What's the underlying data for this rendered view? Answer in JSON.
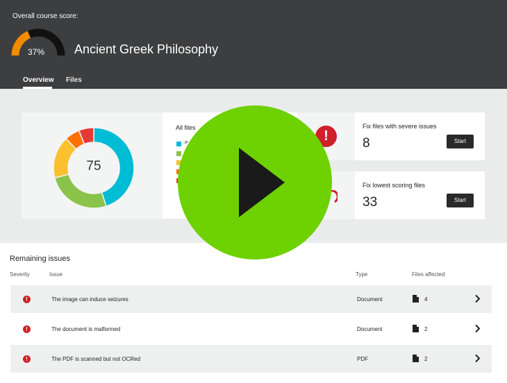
{
  "header": {
    "score_caption": "Overall course score:",
    "score_percent": 37,
    "score_percent_label": "37%",
    "course_title": "Ancient Greek Philosophy",
    "tabs": [
      {
        "label": "Overview",
        "active": true
      },
      {
        "label": "Files",
        "active": false
      }
    ]
  },
  "summary": {
    "donut_value": "75",
    "donut_segments": [
      {
        "color": "#00bcd4",
        "fraction": 0.45
      },
      {
        "color": "#8bc34a",
        "fraction": 0.26
      },
      {
        "color": "#fbc02d",
        "fraction": 0.17
      },
      {
        "color": "#ff6f00",
        "fraction": 0.06
      },
      {
        "color": "#e53935",
        "fraction": 0.06
      }
    ],
    "files_label": "All files",
    "legend": [
      {
        "color": "#00bcd4",
        "text": "P"
      },
      {
        "color": "#8bc34a",
        "text": ""
      },
      {
        "color": "#fbc02d",
        "text": ""
      },
      {
        "color": "#ff6f00",
        "text": ""
      },
      {
        "color": "#e53935",
        "text": ""
      }
    ],
    "severe": {
      "title": "Fix files with severe issues",
      "count": "8",
      "button": "Start",
      "icon": "exclamation-icon"
    },
    "lowest": {
      "title": "Fix lowest scoring files",
      "count": "33",
      "button": "Start",
      "icon": "gauge-icon"
    }
  },
  "play_overlay": {
    "color": "#6ed102",
    "icon": "play-icon"
  },
  "issues": {
    "title": "Remaining issues",
    "columns": [
      "Severity",
      "Issue",
      "Type",
      "Files affected"
    ],
    "rows": [
      {
        "issue": "The image can induce seizures",
        "type": "Document",
        "files": "4"
      },
      {
        "issue": "The document is malformed",
        "type": "Document",
        "files": "2"
      },
      {
        "issue": "The PDF is scanned but not OCRed",
        "type": "PDF",
        "files": "2"
      }
    ]
  },
  "colors": {
    "header_bg": "#3d3e40",
    "gauge_fill": "#f08c00",
    "severity_red": "#d0202b"
  }
}
